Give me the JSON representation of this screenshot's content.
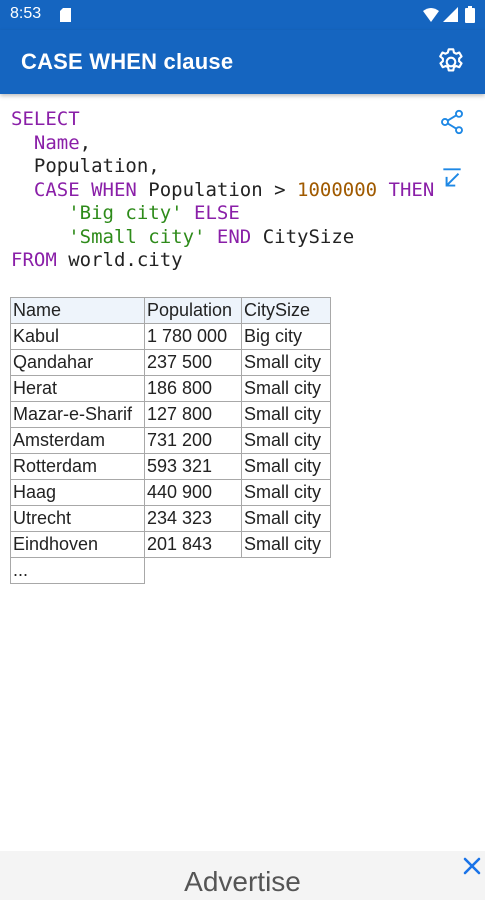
{
  "status_bar": {
    "time": "8:53",
    "icons": [
      "sd-card-icon",
      "wifi-icon",
      "signal-icon",
      "battery-icon"
    ]
  },
  "app_bar": {
    "title": "CASE WHEN clause",
    "settings_icon": "gear-icon"
  },
  "query": {
    "lines": [
      [
        {
          "t": "SELECT",
          "k": "kw"
        }
      ],
      [
        {
          "t": "  Name",
          "k": "kw"
        },
        {
          "t": ",",
          "k": "plain"
        }
      ],
      [
        {
          "t": "  Population,",
          "k": "plain"
        }
      ],
      [
        {
          "t": "  CASE WHEN ",
          "k": "kw"
        },
        {
          "t": "Population > ",
          "k": "plain"
        },
        {
          "t": "1000000",
          "k": "num"
        },
        {
          "t": " THEN",
          "k": "kw"
        }
      ],
      [
        {
          "t": "     ",
          "k": "plain"
        },
        {
          "t": "'Big city'",
          "k": "str"
        },
        {
          "t": " ELSE",
          "k": "kw"
        }
      ],
      [
        {
          "t": "     ",
          "k": "plain"
        },
        {
          "t": "'Small city'",
          "k": "str"
        },
        {
          "t": " END",
          "k": "kw"
        },
        {
          "t": " CitySize",
          "k": "plain"
        }
      ],
      [
        {
          "t": "FROM",
          "k": "kw"
        },
        {
          "t": " world.city",
          "k": "plain"
        }
      ]
    ],
    "share_icon": "share-icon",
    "collapse_icon": "collapse-icon"
  },
  "result": {
    "columns": [
      "Name",
      "Population",
      "CitySize"
    ],
    "rows": [
      [
        "Kabul",
        "1 780 000",
        "Big city"
      ],
      [
        "Qandahar",
        "237 500",
        "Small city"
      ],
      [
        "Herat",
        "186 800",
        "Small city"
      ],
      [
        "Mazar-e-Sharif",
        "127 800",
        "Small city"
      ],
      [
        "Amsterdam",
        "731 200",
        "Small city"
      ],
      [
        "Rotterdam",
        "593 321",
        "Small city"
      ],
      [
        "Haag",
        "440 900",
        "Small city"
      ],
      [
        "Utrecht",
        "234 323",
        "Small city"
      ],
      [
        "Eindhoven",
        "201 843",
        "Small city"
      ]
    ],
    "more": "..."
  },
  "ad": {
    "label": "Advertise",
    "close_icon": "close-icon"
  },
  "colors": {
    "primary": "#1565c0",
    "keyword": "#8a1fa8",
    "string": "#2e8b1a",
    "number": "#a05a00",
    "accent_icon": "#1e88e5"
  }
}
